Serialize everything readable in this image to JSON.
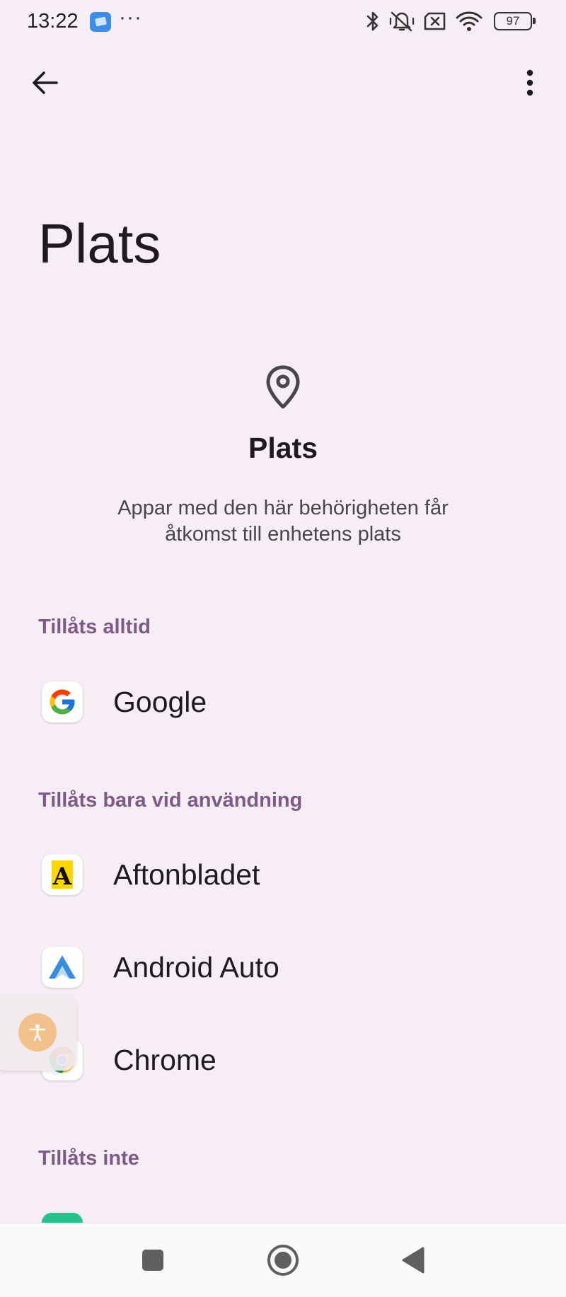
{
  "status_bar": {
    "time": "13:22",
    "dots": "···",
    "battery_level": "97",
    "icons": [
      "bluetooth-icon",
      "vibrate-off-icon",
      "sim-off-icon",
      "wifi-icon",
      "battery-icon"
    ]
  },
  "app_bar": {
    "back_icon": "arrow-left-icon",
    "more_icon": "more-vertical-icon"
  },
  "page": {
    "title": "Plats",
    "header_icon": "location-pin-icon",
    "heading": "Plats",
    "description": "Appar med den här behörigheten får åtkomst till enhetens plats"
  },
  "groups": [
    {
      "label": "Tillåts alltid",
      "apps": [
        {
          "label": "Google",
          "icon": "google-icon"
        }
      ]
    },
    {
      "label": "Tillåts bara vid användning",
      "apps": [
        {
          "label": "Aftonbladet",
          "icon": "aftonbladet-icon"
        },
        {
          "label": "Android Auto",
          "icon": "android-auto-icon"
        },
        {
          "label": "Chrome",
          "icon": "chrome-icon"
        }
      ]
    },
    {
      "label": "Tillåts inte",
      "apps": []
    }
  ],
  "accessibility_icon": "accessibility-icon",
  "nav_bar": {
    "icons": [
      "recents-icon",
      "home-icon",
      "back-triangle-icon"
    ]
  },
  "colors": {
    "background": "#F7EDF4",
    "group_header": "#7D5A87",
    "text": "#1D1B20",
    "secondary_text": "#49454F",
    "nav_bar": "#FAFAFA"
  }
}
